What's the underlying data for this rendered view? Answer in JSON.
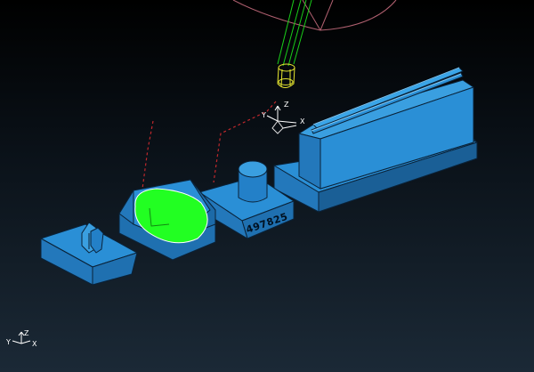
{
  "colors": {
    "background_top": "#000000",
    "background_bottom": "#1b2936",
    "part_face": "#2a8fd6",
    "part_side": "#1c6aa8",
    "part_edge": "#0a2238",
    "toolpath_highlight": "#22ff22",
    "tool_holder_wire": "#19cc19",
    "tool_tip_wire": "#e8e830",
    "rapid_move": "#c0282c",
    "axis_triad": "#ffffff"
  },
  "parts": [
    {
      "id": "part-1",
      "label": ""
    },
    {
      "id": "part-2",
      "label": ""
    },
    {
      "id": "part-3",
      "label": "497825"
    },
    {
      "id": "part-4",
      "label": ""
    }
  ],
  "tool_triad": {
    "x": "X",
    "y": "Y",
    "z": "Z"
  },
  "world_triad": {
    "x": "X",
    "y": "Y",
    "z": "Z"
  }
}
